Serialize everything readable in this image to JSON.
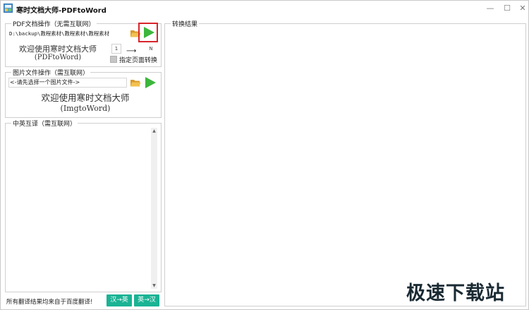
{
  "window": {
    "title": "寒时文档大师-PDFtoWord",
    "controls": {
      "minimize": "—",
      "maximize": "☐",
      "close": "✕"
    }
  },
  "pdf_group": {
    "title": "PDF文档操作（无需互联网）",
    "path_value": "D:\\backup\\教程素材\\教程素材\\教程素材",
    "welcome_line1": "欢迎使用寒时文档大师",
    "welcome_line2": "(PDFtoWord)",
    "page_start": "1",
    "arrow": "⟶",
    "page_end": "N",
    "checkbox_label": "指定页面转换"
  },
  "img_group": {
    "title": "图片文件操作（需互联网）",
    "path_value": "<-请先选择一个图片文件->",
    "welcome_line1": "欢迎使用寒时文档大师",
    "welcome_line2": "(ImgtoWord)"
  },
  "trans_group": {
    "title": "中英互译（需互联网）",
    "note": "所有翻译结果均来自于百度翻译!",
    "btn_cn_en": "汉→英",
    "btn_en_cn": "英→汉"
  },
  "result_group": {
    "title": "转换结果"
  },
  "watermark": "极速下载站",
  "colors": {
    "accent_green": "#1ab394",
    "play_green": "#3cb63c",
    "highlight_red": "#d9252b",
    "folder_yellow": "#e8b13a"
  }
}
